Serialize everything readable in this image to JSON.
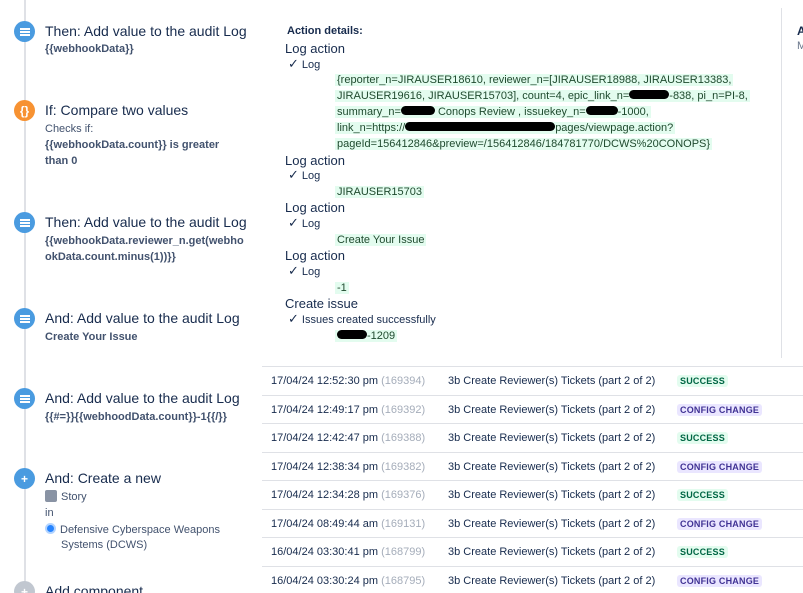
{
  "steps": [
    {
      "title": "Then: Add value to the audit Log",
      "code": "{{webhookData}}"
    },
    {
      "title": "If: Compare two values",
      "sub": "Checks if:",
      "code_lines": [
        "{{webhookData.count}} is greater",
        "than 0"
      ]
    },
    {
      "title": "Then: Add value to the audit Log",
      "code_lines": [
        "{{webhookData.reviewer_n.get(webho",
        "okData.count.minus(1))}}"
      ]
    },
    {
      "title": "And: Add value to the audit Log",
      "code": "Create Your Issue"
    },
    {
      "title": "And: Add value to the audit Log",
      "code": "{{#=}}{{webhoodData.count}}-1{{/}}"
    },
    {
      "title": "And: Create a new",
      "issue_type": "Story",
      "in_label": "in",
      "project_lines": [
        "Defensive Cyberspace Weapons",
        "Systems (DCWS)"
      ]
    },
    {
      "title": "Add component"
    }
  ],
  "details": {
    "heading": "Action details:",
    "actions": [
      {
        "label": "Log action",
        "check": "Log",
        "value_lines": [
          "{reporter_n=JIRAUSER18610, reviewer_n=[JIRAUSER18988, JIRAUSER13383,",
          "JIRAUSER19616, JIRAUSER15703], count=4, epic_link_n=",
          "-838, pi_n=PI-8,",
          "summary_n=",
          "Conops Review , issuekey_n=",
          "-1000,",
          "link_n=https://",
          "pages/viewpage.action?",
          "pageId=156412846&preview=/156412846/184781770/DCWS%20CONOPS}"
        ]
      },
      {
        "label": "Log action",
        "check": "Log",
        "value": "JIRAUSER15703"
      },
      {
        "label": "Log action",
        "check": "Log",
        "value": "Create Your Issue"
      },
      {
        "label": "Log action",
        "check": "Log",
        "value": "-1"
      },
      {
        "label": "Create issue",
        "check": "Issues created successfully",
        "value": "-1209"
      }
    ],
    "edge_letter": "A",
    "edge_letter2": "M"
  },
  "audit_rows": [
    {
      "time": "17/04/24 12:52:30 pm",
      "id": "(169394)",
      "name": "3b Create Reviewer(s) Tickets (part 2 of 2)",
      "status": "SUCCESS"
    },
    {
      "time": "17/04/24 12:49:17 pm",
      "id": "(169392)",
      "name": "3b Create Reviewer(s) Tickets (part 2 of 2)",
      "status": "CONFIG CHANGE"
    },
    {
      "time": "17/04/24 12:42:47 pm",
      "id": "(169388)",
      "name": "3b Create Reviewer(s) Tickets (part 2 of 2)",
      "status": "SUCCESS"
    },
    {
      "time": "17/04/24 12:38:34 pm",
      "id": "(169382)",
      "name": "3b Create Reviewer(s) Tickets (part 2 of 2)",
      "status": "CONFIG CHANGE"
    },
    {
      "time": "17/04/24 12:34:28 pm",
      "id": "(169376)",
      "name": "3b Create Reviewer(s) Tickets (part 2 of 2)",
      "status": "SUCCESS"
    },
    {
      "time": "17/04/24 08:49:44 am",
      "id": "(169131)",
      "name": "3b Create Reviewer(s) Tickets (part 2 of 2)",
      "status": "CONFIG CHANGE"
    },
    {
      "time": "16/04/24 03:30:41 pm",
      "id": "(168799)",
      "name": "3b Create Reviewer(s) Tickets (part 2 of 2)",
      "status": "SUCCESS"
    },
    {
      "time": "16/04/24 03:30:24 pm",
      "id": "(168795)",
      "name": "3b Create Reviewer(s) Tickets (part 2 of 2)",
      "status": "CONFIG CHANGE"
    }
  ],
  "colors": {
    "success_bg": "#e3fcef",
    "config_bg": "#eae6ff",
    "action_blue": "#4a9be0",
    "condition_orange": "#f79232"
  },
  "icons": [
    "log-action-icon",
    "condition-icon",
    "add-icon"
  ]
}
